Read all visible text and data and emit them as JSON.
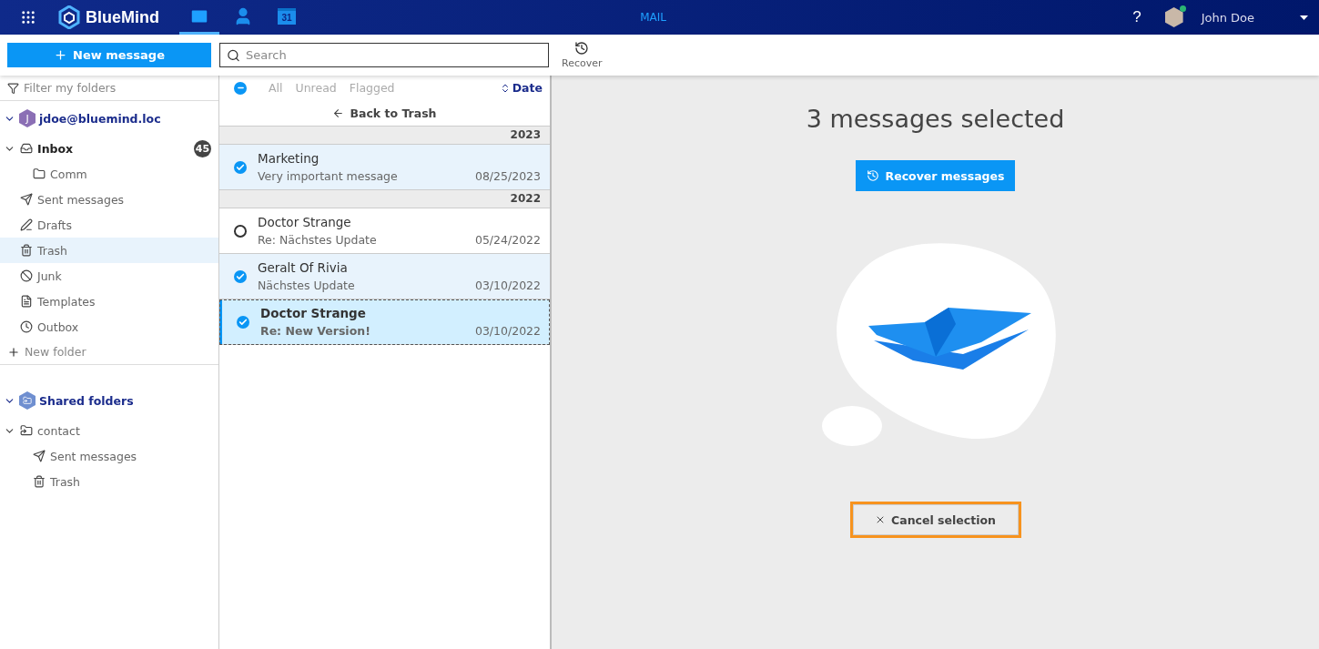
{
  "header": {
    "logo": "BlueMind",
    "apps": [
      {
        "kind": "mail",
        "selected": true
      },
      {
        "kind": "contacts",
        "selected": false
      },
      {
        "kind": "calendar",
        "label": "31",
        "selected": false
      }
    ],
    "title": "MAIL",
    "help": "?",
    "user": {
      "name": "John Doe",
      "online": true
    }
  },
  "toolbar": {
    "new_message": "New message",
    "search": {
      "placeholder": "Search"
    },
    "recover": "Recover"
  },
  "sidebar": {
    "filter": {
      "placeholder": "Filter my folders"
    },
    "account": {
      "avatar": "J",
      "name": "jdoe@bluemind.loc",
      "expanded": true,
      "folders": [
        {
          "kind": "inbox",
          "name": "Inbox",
          "expanded": true,
          "unread": true,
          "count": "45",
          "selected": false,
          "children": [
            {
              "kind": "folder",
              "name": "Comm",
              "unread": false,
              "selected": false
            }
          ]
        },
        {
          "kind": "sent",
          "name": "Sent messages",
          "unread": false,
          "selected": false
        },
        {
          "kind": "drafts",
          "name": "Drafts",
          "unread": false,
          "selected": false
        },
        {
          "kind": "trash",
          "name": "Trash",
          "unread": false,
          "selected": true
        },
        {
          "kind": "junk",
          "name": "Junk",
          "unread": false,
          "selected": false
        },
        {
          "kind": "templates",
          "name": "Templates",
          "unread": false,
          "selected": false
        },
        {
          "kind": "outbox",
          "name": "Outbox",
          "unread": false,
          "selected": false
        }
      ]
    },
    "new_folder": "New folder",
    "shared": {
      "name": "Shared folders",
      "expanded": true,
      "folders": [
        {
          "kind": "shared",
          "name": "contact",
          "expanded": true,
          "unread": false,
          "selected": false,
          "children": [
            {
              "kind": "sent",
              "name": "Sent messages",
              "unread": false,
              "selected": false
            },
            {
              "kind": "trash",
              "name": "Trash",
              "unread": false,
              "selected": false
            }
          ]
        }
      ]
    }
  },
  "list": {
    "select_all": {
      "indeterminate": true
    },
    "filters": [
      {
        "label": "All",
        "selected": false
      },
      {
        "label": "Unread",
        "selected": false
      },
      {
        "label": "Flagged",
        "selected": false
      }
    ],
    "sort": "Date",
    "back": "Back to Trash",
    "groups": [
      {
        "year": "2023",
        "messages": [
          {
            "sender": "Marketing",
            "subject": "Very important message",
            "date": "08/25/2023",
            "checked": true,
            "unread": false,
            "focused": false
          }
        ]
      },
      {
        "year": "2022",
        "messages": [
          {
            "sender": "Doctor Strange",
            "subject": "Re: Nächstes Update",
            "date": "05/24/2022",
            "checked": false,
            "unread": false,
            "focused": false
          },
          {
            "sender": "Geralt Of Rivia",
            "subject": "Nächstes Update",
            "date": "03/10/2022",
            "checked": true,
            "unread": false,
            "focused": false
          },
          {
            "sender": "Doctor Strange",
            "subject": "Re: New Version!",
            "date": "03/10/2022",
            "checked": true,
            "unread": true,
            "focused": true
          }
        ]
      }
    ]
  },
  "pane": {
    "title": "3 messages selected",
    "recover_button": "Recover messages",
    "cancel_button": {
      "label": "Cancel selection",
      "focused": true
    }
  }
}
